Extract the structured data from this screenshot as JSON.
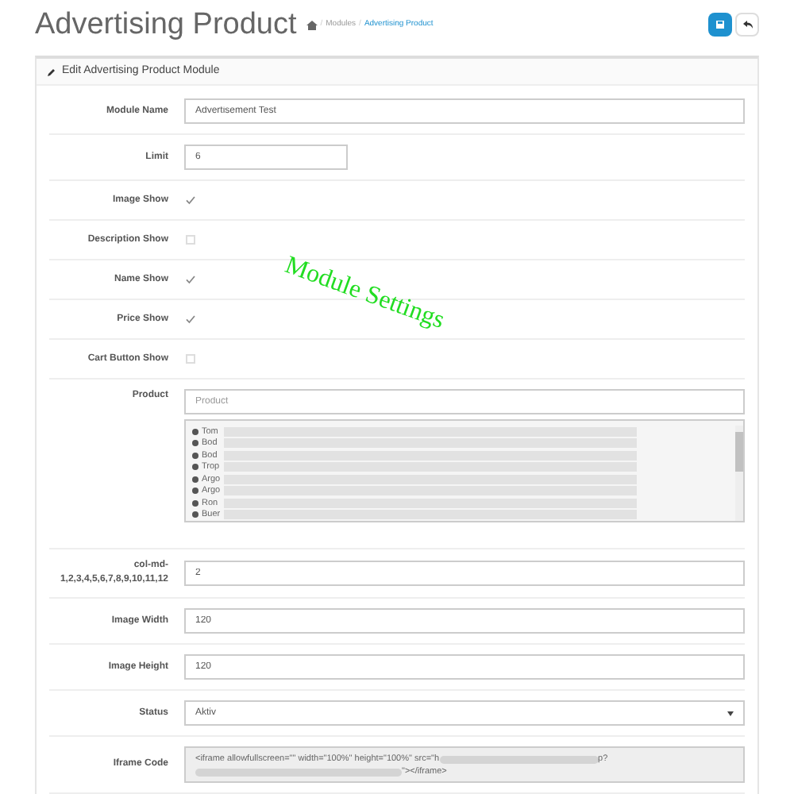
{
  "header": {
    "title": "Advertising Product",
    "separator": "/",
    "breadcrumb": [
      "Modules",
      "Advertising Product"
    ]
  },
  "panel": {
    "heading": "Edit Advertising Product Module",
    "annotation": "Module Settings",
    "rows": [
      {
        "kind": "text",
        "label": "Module Name",
        "value": "Advertisement Test"
      },
      {
        "kind": "short-text",
        "label": "Limit",
        "value": "6"
      },
      {
        "kind": "checkbox",
        "label": "Image Show",
        "checked": true
      },
      {
        "kind": "checkbox",
        "label": "Description Show",
        "checked": false
      },
      {
        "kind": "checkbox",
        "label": "Name Show",
        "checked": true
      },
      {
        "kind": "checkbox",
        "label": "Price Show",
        "checked": true
      },
      {
        "kind": "checkbox",
        "label": "Cart Button Show",
        "checked": false
      },
      {
        "kind": "product",
        "label": "Product",
        "placeholder": "Product",
        "items": [
          "Tom",
          "Bod",
          "Bod",
          "Trop",
          "Argo",
          "Argo",
          "Ron",
          "Buer"
        ]
      },
      {
        "kind": "text",
        "label": "col-md-1,2,3,4,5,6,7,8,9,10,11,12",
        "value": "2"
      },
      {
        "kind": "text",
        "label": "Image Width",
        "value": "120"
      },
      {
        "kind": "text",
        "label": "Image Height",
        "value": "120"
      },
      {
        "kind": "select",
        "label": "Status",
        "value": "Aktiv"
      },
      {
        "kind": "code",
        "label": "Iframe Code",
        "lines": [
          {
            "before": "<iframe allowfullscreen=\"\" width=\"100%\" height=\"100%\" src=\"h",
            "after": "p?"
          },
          {
            "after": "\"></iframe>"
          }
        ]
      }
    ]
  }
}
